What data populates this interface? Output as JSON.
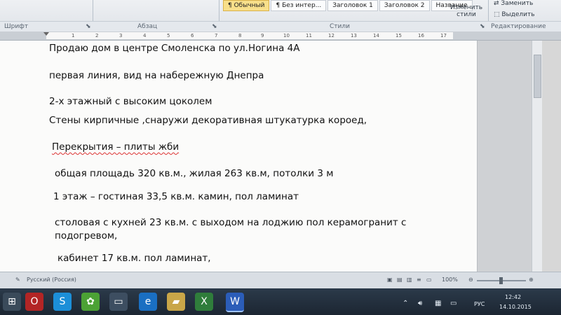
{
  "ribbon": {
    "groups": {
      "font": "Шрифт",
      "paragraph": "Абзац",
      "styles": "Стили",
      "editing": "Редактирование"
    },
    "styles": [
      "¶ Обычный",
      "¶ Без интер...",
      "Заголовок 1",
      "Заголовок 2",
      "Название"
    ],
    "change_styles": "Изменить стили",
    "replace": "Заменить",
    "select": "Выделить"
  },
  "ruler": {
    "ticks": [
      "1",
      "2",
      "3",
      "4",
      "5",
      "6",
      "7",
      "8",
      "9",
      "10",
      "11",
      "12",
      "13",
      "14",
      "15",
      "16",
      "17"
    ]
  },
  "document": {
    "lines": [
      "Продаю дом в центре Смоленска по ул.Ногина 4А",
      "первая линия, вид на набережную  Днепра",
      "2-х этажный с высоким цоколем",
      "Стены кирпичные  ,снаружи декоративная  штукатурка короед,",
      "Перекрытия – плиты жби",
      "общая площадь 320 кв.м., жилая 263 кв.м, потолки 3 м",
      "1 этаж – гостиная 33,5  кв.м. камин, пол ламинат",
      "столовая с кухней 23 кв.м. с выходом на лоджию пол керамогранит с",
      "подогревом,",
      "кабинет 17 кв.м. пол ламинат,"
    ]
  },
  "status": {
    "language": "Русский (Россия)",
    "zoom": "100%"
  },
  "taskbar": {
    "lang": "РУС",
    "time": "12:42",
    "date": "14.10.2015"
  }
}
